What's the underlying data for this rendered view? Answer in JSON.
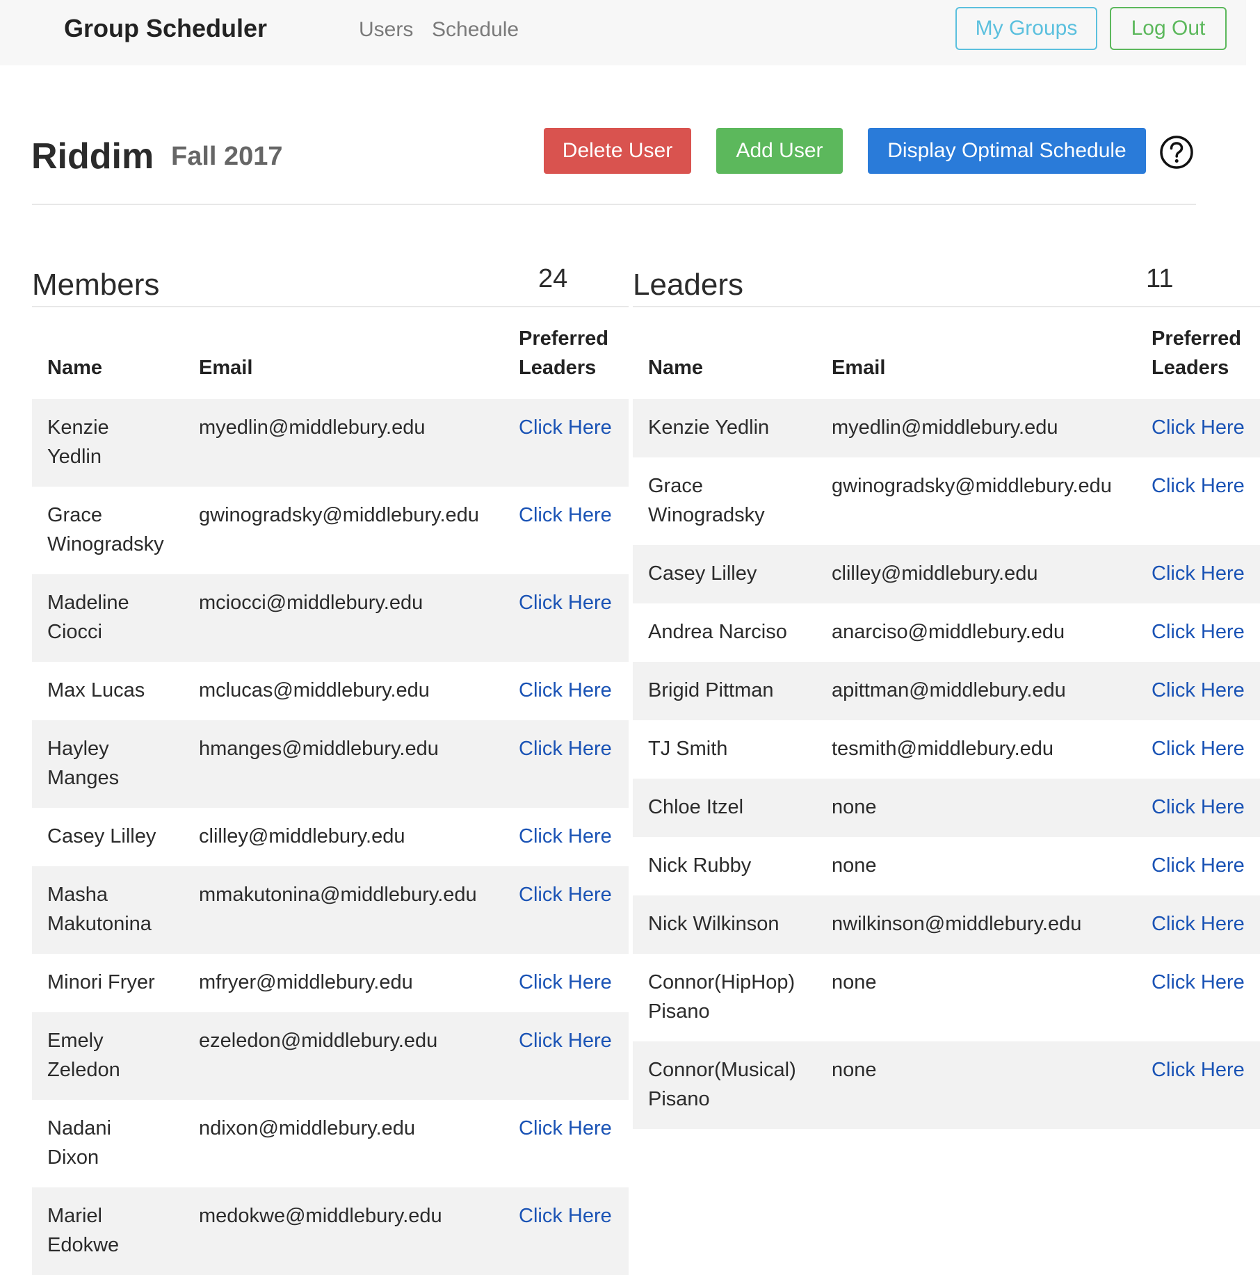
{
  "navbar": {
    "brand": "Group Scheduler",
    "links": [
      "Users",
      "Schedule"
    ],
    "my_groups_label": "My Groups",
    "logout_label": "Log Out"
  },
  "group": {
    "name": "Riddim",
    "term": "Fall 2017"
  },
  "actions": {
    "delete_label": "Delete User",
    "add_label": "Add User",
    "display_label": "Display Optimal Schedule",
    "help_icon": "question-circle-icon"
  },
  "members": {
    "title": "Members",
    "count": "24",
    "headers": {
      "name": "Name",
      "email": "Email",
      "preferred": "Preferred Leaders"
    },
    "rows": [
      {
        "name": "Kenzie Yedlin",
        "email": "myedlin@middlebury.edu",
        "link": "Click Here"
      },
      {
        "name": "Grace Winogradsky",
        "email": "gwinogradsky@middlebury.edu",
        "link": "Click Here"
      },
      {
        "name": "Madeline Ciocci",
        "email": "mciocci@middlebury.edu",
        "link": "Click Here"
      },
      {
        "name": "Max Lucas",
        "email": "mclucas@middlebury.edu",
        "link": "Click Here"
      },
      {
        "name": "Hayley Manges",
        "email": "hmanges@middlebury.edu",
        "link": "Click Here"
      },
      {
        "name": "Casey Lilley",
        "email": "clilley@middlebury.edu",
        "link": "Click Here"
      },
      {
        "name": "Masha Makutonina",
        "email": "mmakutonina@middlebury.edu",
        "link": "Click Here"
      },
      {
        "name": "Minori Fryer",
        "email": "mfryer@middlebury.edu",
        "link": "Click Here"
      },
      {
        "name": "Emely Zeledon",
        "email": "ezeledon@middlebury.edu",
        "link": "Click Here"
      },
      {
        "name": "Nadani Dixon",
        "email": "ndixon@middlebury.edu",
        "link": "Click Here"
      },
      {
        "name": "Mariel Edokwe",
        "email": "medokwe@middlebury.edu",
        "link": "Click Here"
      }
    ]
  },
  "leaders": {
    "title": "Leaders",
    "count": "11",
    "headers": {
      "name": "Name",
      "email": "Email",
      "preferred": "Preferred Leaders"
    },
    "rows": [
      {
        "name": "Kenzie Yedlin",
        "email": "myedlin@middlebury.edu",
        "link": "Click Here"
      },
      {
        "name": "Grace Winogradsky",
        "email": "gwinogradsky@middlebury.edu",
        "link": "Click Here"
      },
      {
        "name": "Casey Lilley",
        "email": "clilley@middlebury.edu",
        "link": "Click Here"
      },
      {
        "name": "Andrea Narciso",
        "email": "anarciso@middlebury.edu",
        "link": "Click Here"
      },
      {
        "name": "Brigid Pittman",
        "email": "apittman@middlebury.edu",
        "link": "Click Here"
      },
      {
        "name": "TJ Smith",
        "email": "tesmith@middlebury.edu",
        "link": "Click Here"
      },
      {
        "name": "Chloe Itzel",
        "email": "none",
        "link": "Click Here"
      },
      {
        "name": "Nick Rubby",
        "email": "none",
        "link": "Click Here"
      },
      {
        "name": "Nick Wilkinson",
        "email": "nwilkinson@middlebury.edu",
        "link": "Click Here"
      },
      {
        "name": "Connor(HipHop) Pisano",
        "email": "none",
        "link": "Click Here"
      },
      {
        "name": "Connor(Musical) Pisano",
        "email": "none",
        "link": "Click Here"
      }
    ]
  }
}
